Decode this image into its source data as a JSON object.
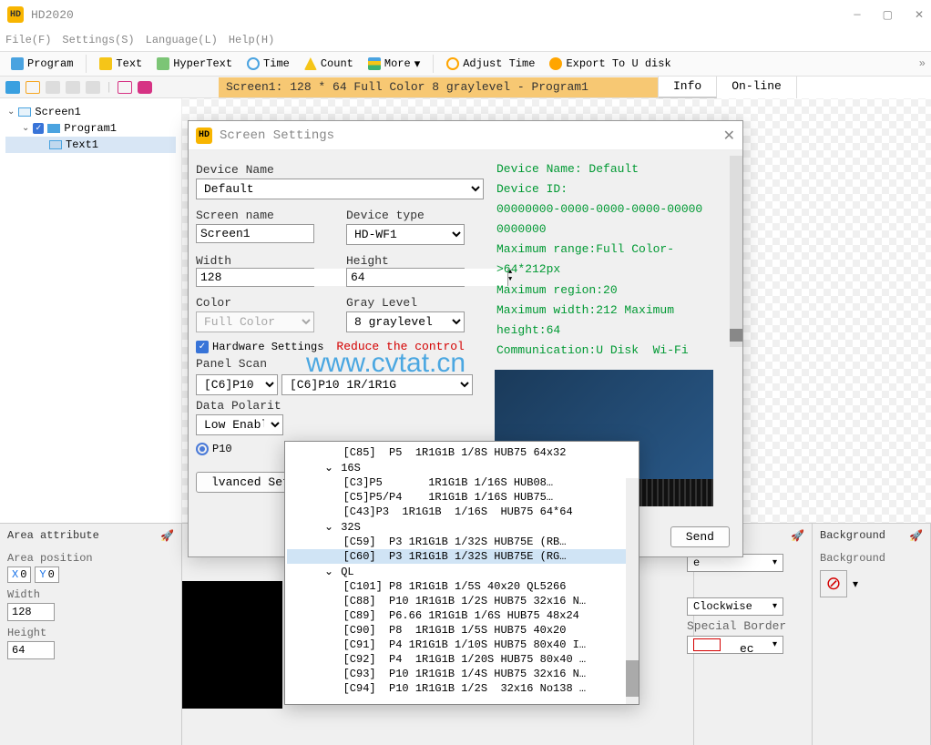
{
  "app": {
    "title": "HD2020"
  },
  "menu": {
    "file": "File(F)",
    "settings": "Settings(S)",
    "language": "Language(L)",
    "help": "Help(H)"
  },
  "toolbar": {
    "program": "Program",
    "text": "Text",
    "hypertext": "HyperText",
    "time": "Time",
    "count": "Count",
    "more": "More",
    "adjust": "Adjust Time",
    "export": "Export To U disk"
  },
  "status_bar": "Screen1: 128 * 64 Full Color 8 graylevel - Program1",
  "right_tabs": {
    "info": "Info",
    "online": "On-line"
  },
  "tree": {
    "screen": "Screen1",
    "program": "Program1",
    "text": "Text1"
  },
  "area_panel": {
    "title": "Area attribute",
    "pos_label": "Area position",
    "x": "0",
    "y": "0",
    "width_label": "Width",
    "width": "128",
    "height_label": "Height",
    "height": "64"
  },
  "border_title": "r",
  "border_labels": {
    "e": "e",
    "sb": "Special Border"
  },
  "drop_clockwise": "Clockwise",
  "bg_panel": {
    "title": "Background",
    "label": "Background"
  },
  "ec_fragment": "ec",
  "ss": {
    "title": "Screen Settings",
    "device_name_label": "Device Name",
    "device_name": "Default",
    "screen_name_label": "Screen name",
    "screen_name": "Screen1",
    "device_type_label": "Device type",
    "device_type": "HD-WF1",
    "width_label": "Width",
    "width": "128",
    "height_label": "Height",
    "height": "64",
    "color_label": "Color",
    "color": "Full Color",
    "gray_label": "Gray Level",
    "gray": "8 graylevel",
    "hw_check": "Hardware Settings",
    "reduce": "Reduce the control",
    "panel_scan": "Panel Scan",
    "scan1": "[C6]P10",
    "scan2": "[C6]P10",
    "scan3": "1R/1R1G",
    "data_pol": "Data Polarit",
    "low_enable": "Low Enable",
    "radio_p10": "P10",
    "adv": "lvanced Sett",
    "send": "Send",
    "info_lines": "Device Name: Default\nDevice ID:\n00000000-0000-0000-0000-00000\n0000000\nMaximum range:Full Color-\n>64*212px\nMaximum region:20\nMaximum width:212 Maximum\nheight:64\nCommunication:U Disk  Wi-Fi"
  },
  "popup": {
    "items": [
      "        [C85]  P5  1R1G1B 1/8S HUB75 64x32",
      "hdr:16S",
      "        [C3]P5       1R1G1B 1/16S HUB08…",
      "        [C5]P5/P4    1R1G1B 1/16S HUB75…",
      "        [C43]P3  1R1G1B  1/16S  HUB75 64*64",
      "hdr:32S",
      "        [C59]  P3 1R1G1B 1/32S HUB75E (RB…",
      "sel:        [C60]  P3 1R1G1B 1/32S HUB75E (RG…",
      "hdr:QL",
      "        [C101] P8 1R1G1B 1/5S 40x20 QL5266",
      "        [C88]  P10 1R1G1B 1/2S HUB75 32x16 N…",
      "        [C89]  P6.66 1R1G1B 1/6S HUB75 48x24",
      "        [C90]  P8  1R1G1B 1/5S HUB75 40x20",
      "        [C91]  P4 1R1G1B 1/10S HUB75 80x40 I…",
      "        [C92]  P4  1R1G1B 1/20S HUB75 80x40 …",
      "        [C93]  P10 1R1G1B 1/4S HUB75 32x16 N…",
      "        [C94]  P10 1R1G1B 1/2S  32x16 No138 …"
    ]
  },
  "watermark": "www.cvtat.cn"
}
